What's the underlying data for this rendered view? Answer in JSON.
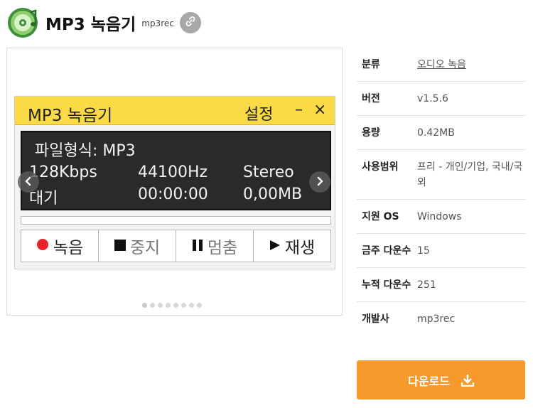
{
  "app": {
    "title": "MP3 녹음기",
    "id": "mp3rec"
  },
  "screenshot": {
    "title": "MP3 녹음기",
    "settings": "설정",
    "minimize": "–",
    "close": "×",
    "format_line": "파일형식: MP3",
    "bitrate": "128Kbps",
    "samplerate": "44100Hz",
    "channel": "Stereo",
    "status": "대기",
    "time": "00:00:00",
    "size": "0,00MB",
    "buttons": {
      "record": "녹음",
      "stop": "중지",
      "pause": "멈춤",
      "play": "재생"
    }
  },
  "gallery": {
    "dot_count": 8,
    "active_dot": 0
  },
  "info": {
    "category_label": "분류",
    "category_value": "오디오 녹음",
    "version_label": "버전",
    "version_value": "v1.5.6",
    "size_label": "용량",
    "size_value": "0.42MB",
    "license_label": "사용범위",
    "license_value": "프리 - 개인/기업, 국내/국외",
    "os_label": "지원 OS",
    "os_value": "Windows",
    "weekly_label": "금주 다운수",
    "weekly_value": "15",
    "total_label": "누적 다운수",
    "total_value": "251",
    "developer_label": "개발사",
    "developer_value": "mp3rec"
  },
  "download": {
    "label": "다운로드"
  },
  "colors": {
    "accent": "#f79a2c",
    "titlebar": "#fbdb45",
    "record_dot": "#e8232a"
  }
}
